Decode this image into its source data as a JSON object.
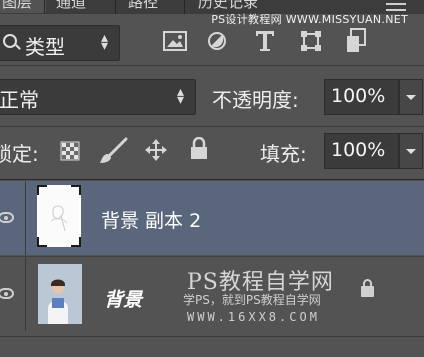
{
  "tabs": [
    {
      "label": "图层",
      "active": true
    },
    {
      "label": "通道",
      "active": false
    },
    {
      "label": "路径",
      "active": false
    },
    {
      "label": "历史记录",
      "active": false
    }
  ],
  "site_watermark_top": "PS设计教程网  WWW.MISSYUAN.NET",
  "filter": {
    "kind_label": "类型",
    "icons": [
      "image-filter-icon",
      "adjustment-filter-icon",
      "type-filter-icon",
      "shape-filter-icon",
      "smart-object-filter-icon"
    ]
  },
  "blend": {
    "mode": "正常",
    "opacity_label": "不透明度:",
    "opacity_value": "100%"
  },
  "locks": {
    "label": "锁定:",
    "icons": [
      "lock-transparent-icon",
      "lock-image-icon",
      "lock-position-icon",
      "lock-all-icon"
    ],
    "fill_label": "填充:",
    "fill_value": "100%"
  },
  "layers": [
    {
      "name": "背景 副本 2",
      "selected": true,
      "visible": true,
      "locked": false
    },
    {
      "name": "背景",
      "selected": false,
      "visible": true,
      "locked": true
    }
  ],
  "watermark": {
    "line1": "PS教程自学网",
    "line2": "学PS，就到PS教程自学网",
    "line3": "WWW.16XX8.COM"
  },
  "colors": {
    "panel_bg": "#535353",
    "selected_layer": "#59667c",
    "field_bg": "#3b3b3b"
  }
}
